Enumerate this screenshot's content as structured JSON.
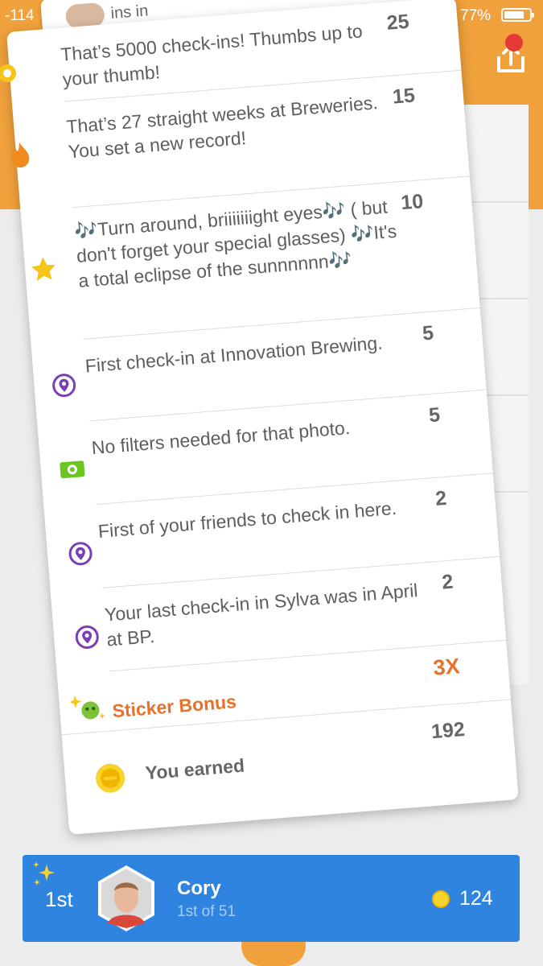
{
  "status_bar": {
    "carrier": "-114",
    "battery_percent": "77%"
  },
  "top_card": {
    "text": "ins in"
  },
  "points": {
    "rows": [
      {
        "icon": "sun-badge-icon",
        "text": "That’s 5000 check-ins! Thumbs up to your thumb!",
        "points": "25"
      },
      {
        "icon": "flame-icon",
        "text": "That’s 27 straight weeks at Breweries. You set a new record!",
        "points": "15"
      },
      {
        "icon": "star-icon",
        "text": "🎶Turn around, briiiiiiight eyes🎶 ( but don't forget your special glasses) 🎶It's a total eclipse of the sunnnnnn🎶",
        "points": "10"
      },
      {
        "icon": "location-pin-icon",
        "text": "First check-in at Innovation Brewing.",
        "points": "5"
      },
      {
        "icon": "camera-icon",
        "text": "No filters needed for that photo.",
        "points": "5"
      },
      {
        "icon": "location-pin-icon",
        "text": "First of your friends to check in here.",
        "points": "2"
      },
      {
        "icon": "location-pin-icon",
        "text": "Your last check-in in Sylva was in April at BP.",
        "points": "2"
      }
    ],
    "bonus": {
      "icon": "sticker-icon",
      "label": "Sticker Bonus",
      "value": "3X"
    },
    "earned": {
      "icon": "coin-icon",
      "label": "You earned",
      "value": "192"
    }
  },
  "leaderboard": {
    "rank": "1st",
    "name": "Cory",
    "position": "1st of 51",
    "coins": "124"
  },
  "colors": {
    "orange": "#f0a13c",
    "blue": "#2f84e0",
    "accent_orange_text": "#e8722c",
    "purple_pin": "#7b3fb5",
    "green_camera": "#6cc51f",
    "star_yellow": "#f5c518"
  }
}
